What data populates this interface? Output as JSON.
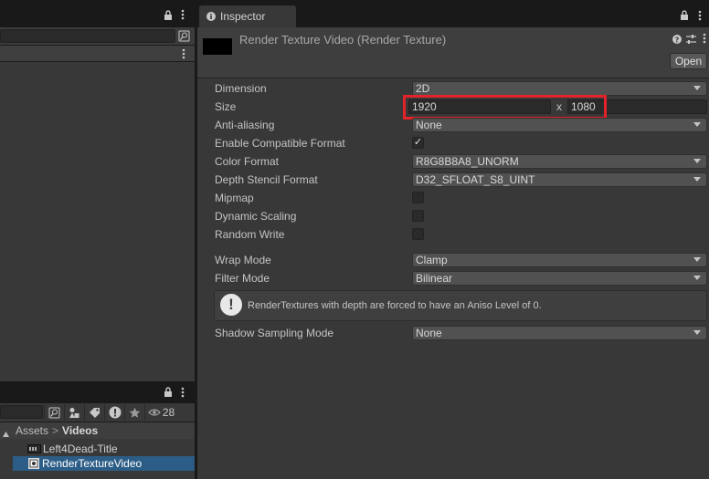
{
  "left_panel": {
    "lock_icon": "lock-icon",
    "menu_icon": "kebab-menu-icon",
    "object_picker_icon": "object-picker-icon"
  },
  "project_panel": {
    "toolbar": {
      "hidden_count": "28",
      "buttons": [
        "object-picker-icon",
        "filter-by-type-icon",
        "filter-by-label-icon",
        "console-warning-icon",
        "favorite-star-icon",
        "eye-icon"
      ]
    },
    "breadcrumb": {
      "root": "Assets",
      "separator": ">",
      "current": "Videos"
    },
    "assets": [
      {
        "name": "Left4Dead-Title",
        "icon": "video-clip-icon",
        "selected": false
      },
      {
        "name": "RenderTextureVideo",
        "icon": "render-texture-icon",
        "selected": true
      }
    ]
  },
  "inspector": {
    "tab_label": "Inspector",
    "tab_icon": "info-icon",
    "asset_title": "Render Texture Video (Render Texture)",
    "open_button": "Open",
    "header_icons": [
      "help-icon",
      "preset-sliders-icon",
      "kebab-menu-icon"
    ],
    "properties": {
      "dimension": {
        "label": "Dimension",
        "value": "2D"
      },
      "size": {
        "label": "Size",
        "width": "1920",
        "separator": "x",
        "height": "1080"
      },
      "anti_aliasing": {
        "label": "Anti-aliasing",
        "value": "None"
      },
      "enable_compatible_format": {
        "label": "Enable Compatible Format",
        "checked": true,
        "mark": "✓"
      },
      "color_format": {
        "label": "Color Format",
        "value": "R8G8B8A8_UNORM"
      },
      "depth_stencil_format": {
        "label": "Depth Stencil Format",
        "value": "D32_SFLOAT_S8_UINT"
      },
      "mipmap": {
        "label": "Mipmap",
        "checked": false
      },
      "dynamic_scaling": {
        "label": "Dynamic Scaling",
        "checked": false
      },
      "random_write": {
        "label": "Random Write",
        "checked": false
      },
      "wrap_mode": {
        "label": "Wrap Mode",
        "value": "Clamp"
      },
      "filter_mode": {
        "label": "Filter Mode",
        "value": "Bilinear"
      },
      "help_message": "RenderTextures with depth are forced to have an Aniso Level of 0.",
      "shadow_sampling_mode": {
        "label": "Shadow Sampling Mode",
        "value": "None"
      }
    },
    "highlight_color": "#e2232a",
    "selection_color": "#2c5d87"
  }
}
